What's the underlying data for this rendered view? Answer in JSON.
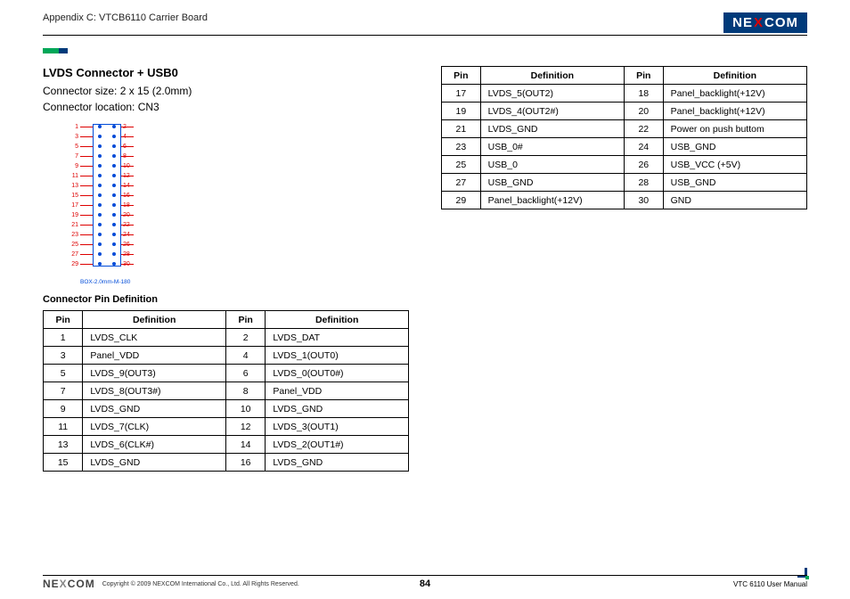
{
  "header": {
    "appendix": "Appendix C: VTCB6110 Carrier Board",
    "logo_text_pre": "NE",
    "logo_text_x": "X",
    "logo_text_post": "COM"
  },
  "section": {
    "title": "LVDS Connector + USB0",
    "size_line": "Connector size:  2 x 15 (2.0mm)",
    "location_line": "Connector location: CN3",
    "diagram_caption": "BOX-2.0mm-M-180",
    "pin_def_title": "Connector Pin Definition"
  },
  "table_headers": {
    "pin": "Pin",
    "definition": "Definition"
  },
  "pins_left": [
    {
      "pin": "1",
      "def": "LVDS_CLK",
      "pin2": "2",
      "def2": "LVDS_DAT"
    },
    {
      "pin": "3",
      "def": "Panel_VDD",
      "pin2": "4",
      "def2": "LVDS_1(OUT0)"
    },
    {
      "pin": "5",
      "def": "LVDS_9(OUT3)",
      "pin2": "6",
      "def2": "LVDS_0(OUT0#)"
    },
    {
      "pin": "7",
      "def": "LVDS_8(OUT3#)",
      "pin2": "8",
      "def2": "Panel_VDD"
    },
    {
      "pin": "9",
      "def": "LVDS_GND",
      "pin2": "10",
      "def2": "LVDS_GND"
    },
    {
      "pin": "11",
      "def": "LVDS_7(CLK)",
      "pin2": "12",
      "def2": "LVDS_3(OUT1)"
    },
    {
      "pin": "13",
      "def": "LVDS_6(CLK#)",
      "pin2": "14",
      "def2": "LVDS_2(OUT1#)"
    },
    {
      "pin": "15",
      "def": "LVDS_GND",
      "pin2": "16",
      "def2": "LVDS_GND"
    }
  ],
  "pins_right": [
    {
      "pin": "17",
      "def": "LVDS_5(OUT2)",
      "pin2": "18",
      "def2": "Panel_backlight(+12V)"
    },
    {
      "pin": "19",
      "def": "LVDS_4(OUT2#)",
      "pin2": "20",
      "def2": "Panel_backlight(+12V)"
    },
    {
      "pin": "21",
      "def": "LVDS_GND",
      "pin2": "22",
      "def2": "Power on push buttom"
    },
    {
      "pin": "23",
      "def": "USB_0#",
      "pin2": "24",
      "def2": "USB_GND"
    },
    {
      "pin": "25",
      "def": "USB_0",
      "pin2": "26",
      "def2": "USB_VCC (+5V)"
    },
    {
      "pin": "27",
      "def": "USB_GND",
      "pin2": "28",
      "def2": "USB_GND"
    },
    {
      "pin": "29",
      "def": "Panel_backlight(+12V)",
      "pin2": "30",
      "def2": "GND"
    }
  ],
  "diagram_pin_count": 15,
  "footer": {
    "logo_pre": "NE",
    "logo_x": "X",
    "logo_post": "COM",
    "copyright": "Copyright © 2009 NEXCOM International Co., Ltd. All Rights Reserved.",
    "page_number": "84",
    "manual": "VTC 6110 User Manual"
  }
}
